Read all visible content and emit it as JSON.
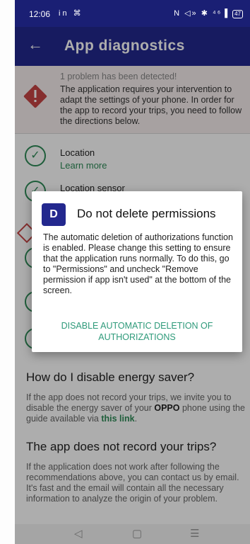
{
  "status_bar": {
    "time": "12:06",
    "left_icons": "in ⌘",
    "right_icons": "N ◁» ✱ ⁴⁶▐",
    "battery": "47"
  },
  "app_bar": {
    "title": "App diagnostics",
    "back_icon": "arrow-left-icon"
  },
  "alert": {
    "summary": "1 problem has been detected!",
    "message": "The application requires your intervention to adapt the settings of your phone. In order for the app to record your trips, you need to follow the directions below."
  },
  "checks": [
    {
      "label": "Location",
      "link": "Learn more"
    },
    {
      "label": "Location sensor"
    }
  ],
  "energy_section": {
    "title": "How do I disable energy saver?",
    "text_before": "If the app does not record your trips, we invite you to disable the energy saver of your ",
    "brand": "OPPO",
    "text_mid": " phone using the guide available via ",
    "link": "this link",
    "text_end": "."
  },
  "trips_section": {
    "title": "The app does not record your trips?",
    "text": "If the application does not work after following the recommendations above, you can contact us by email. It's fast and the email will contain all the necessary information to analyze the origin of your problem."
  },
  "dialog": {
    "icon_glyph": "D",
    "title": "Do not delete permissions",
    "body": "The automatic deletion of authorizations function is enabled. Please change this setting to ensure that the application runs normally. To do this, go to \"Permissions\" and uncheck \"Remove permission if app isn't used\" at the bottom of the screen.",
    "action_label": "DISABLE AUTOMATIC DELETION OF AUTHORIZATIONS"
  },
  "navbar": {
    "back": "◁",
    "home": "▢",
    "menu": "☰"
  },
  "colors": {
    "primary": "#23288e",
    "success": "#2e8b57",
    "error": "#c64545",
    "accent": "#2e9a7a"
  }
}
